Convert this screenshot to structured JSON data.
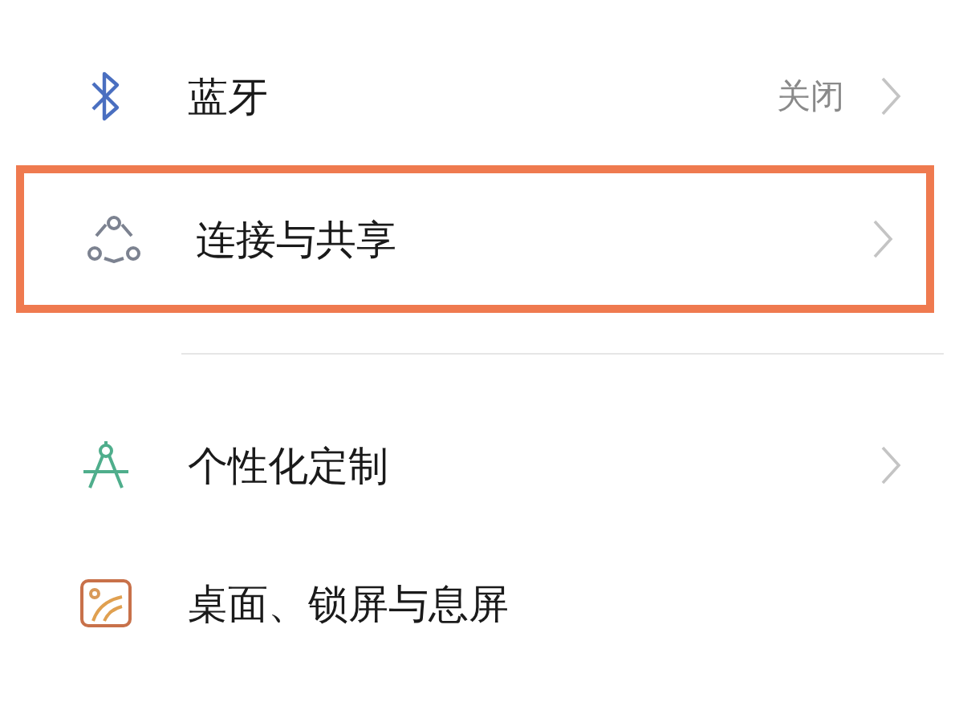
{
  "groups": [
    {
      "items": [
        {
          "kind": "bluetooth",
          "label": "蓝牙",
          "value": "关闭",
          "chevron": true,
          "highlighted": false
        },
        {
          "kind": "share",
          "label": "连接与共享",
          "chevron": true,
          "highlighted": true
        }
      ]
    },
    {
      "items": [
        {
          "kind": "compass",
          "label": "个性化定制",
          "chevron": true,
          "highlighted": false
        },
        {
          "kind": "wallpaper",
          "label": "桌面、锁屏与息屏",
          "chevron": false,
          "highlighted": false
        }
      ]
    }
  ]
}
